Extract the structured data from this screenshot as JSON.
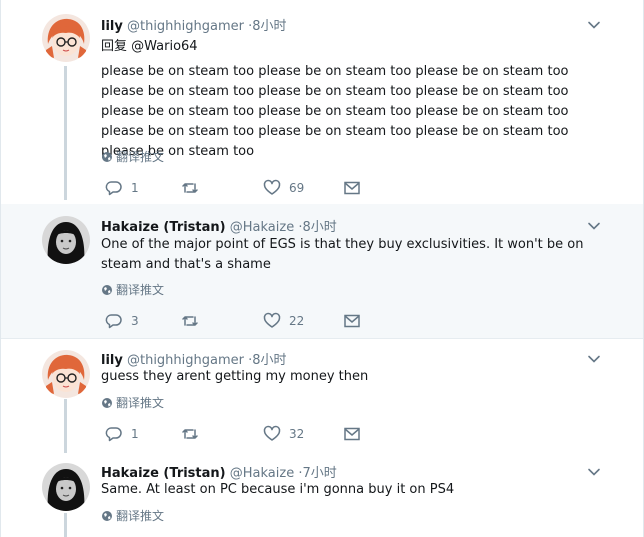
{
  "tweets": [
    {
      "name": "lily",
      "handle": "@thighhighgamer",
      "separator": "·",
      "time": "8小时",
      "reply_to": "回复 @Wario64",
      "text": "please be on steam too please be on steam too please be on steam too please be on steam too please be on steam too please be on steam too please be on steam too please be on steam too please be on steam too please be on steam too please be on steam too please be on steam too please be on steam too",
      "translate": "翻译推文",
      "replies": "1",
      "retweets": "",
      "likes": "69"
    },
    {
      "name": "Hakaize (Tristan)",
      "handle": "@Hakaize",
      "separator": "·",
      "time": "8小时",
      "text": "One of the major point of EGS is that they buy exclusivities. It won't be on steam and that's a shame",
      "translate": "翻译推文",
      "replies": "3",
      "retweets": "",
      "likes": "22"
    },
    {
      "name": "lily",
      "handle": "@thighhighgamer",
      "separator": "·",
      "time": "8小时",
      "text": "guess they arent getting my money then",
      "translate": "翻译推文",
      "replies": "1",
      "retweets": "",
      "likes": "32"
    },
    {
      "name": "Hakaize (Tristan)",
      "handle": "@Hakaize",
      "separator": "·",
      "time": "7小时",
      "text": "Same. At least on PC because i'm gonna buy it on PS4",
      "translate": "翻译推文"
    }
  ],
  "icons": {
    "reply": "reply-icon",
    "retweet": "retweet-icon",
    "like": "heart-icon",
    "dm": "envelope-icon",
    "caret": "chevron-down-icon",
    "globe": "globe-icon"
  },
  "colors": {
    "text": "#14171a",
    "secondary": "#657786",
    "thread_line": "#ccd6dd",
    "highlight_bg": "#f5f8fa"
  }
}
